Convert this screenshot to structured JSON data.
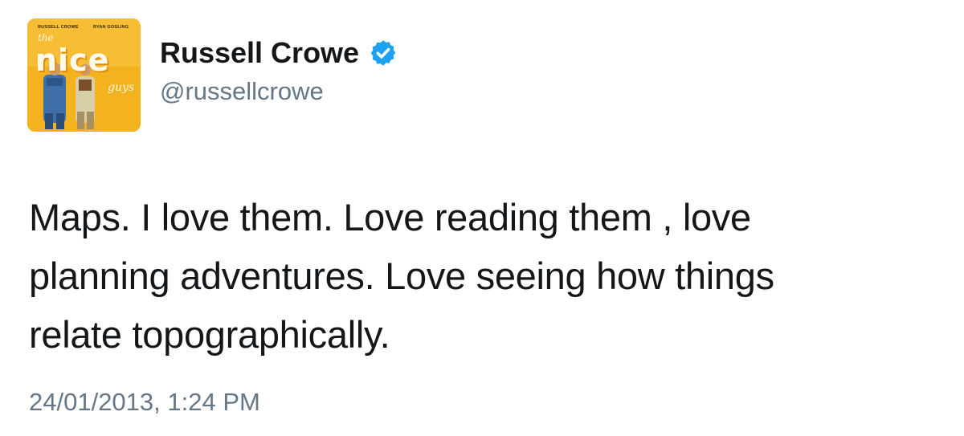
{
  "avatar": {
    "credit_left": "RUSSELL CROWE",
    "credit_right": "RYAN GOSLING",
    "title_the": "the",
    "title_main": "nice",
    "title_guys": "guys",
    "bg_color": "#f5b21f"
  },
  "user": {
    "display_name": "Russell Crowe",
    "handle": "@russellcrowe",
    "verified_icon": "verified-badge-icon",
    "verified_color": "#1da1f2"
  },
  "tweet": {
    "lines": [
      "Maps. I love them. Love reading them , love",
      "planning adventures. Love seeing how things",
      "relate topographically."
    ],
    "timestamp": "24/01/2013, 1:24 PM"
  }
}
